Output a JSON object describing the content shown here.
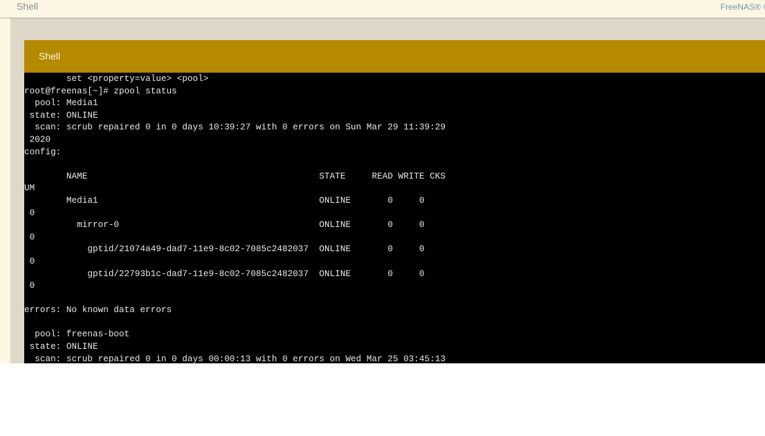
{
  "topbar": {
    "title": "Shell",
    "brand": "FreeNAS® ©"
  },
  "card": {
    "title": "Shell"
  },
  "terminal": {
    "lines": [
      "        set <property=value> <pool>",
      "root@freenas[~]# zpool status",
      "  pool: Media1",
      " state: ONLINE",
      "  scan: scrub repaired 0 in 0 days 10:39:27 with 0 errors on Sun Mar 29 11:39:29",
      " 2020",
      "config:",
      "",
      "        NAME                                            STATE     READ WRITE CKS",
      "UM",
      "        Media1                                          ONLINE       0     0",
      " 0",
      "          mirror-0                                      ONLINE       0     0",
      " 0",
      "            gptid/21074a49-dad7-11e9-8c02-7085c2482037  ONLINE       0     0",
      " 0",
      "            gptid/22793b1c-dad7-11e9-8c02-7085c2482037  ONLINE       0     0",
      " 0",
      "",
      "errors: No known data errors",
      "",
      "  pool: freenas-boot",
      " state: ONLINE",
      "  scan: scrub repaired 0 in 0 days 00:00:13 with 0 errors on Wed Mar 25 03:45:13"
    ]
  }
}
